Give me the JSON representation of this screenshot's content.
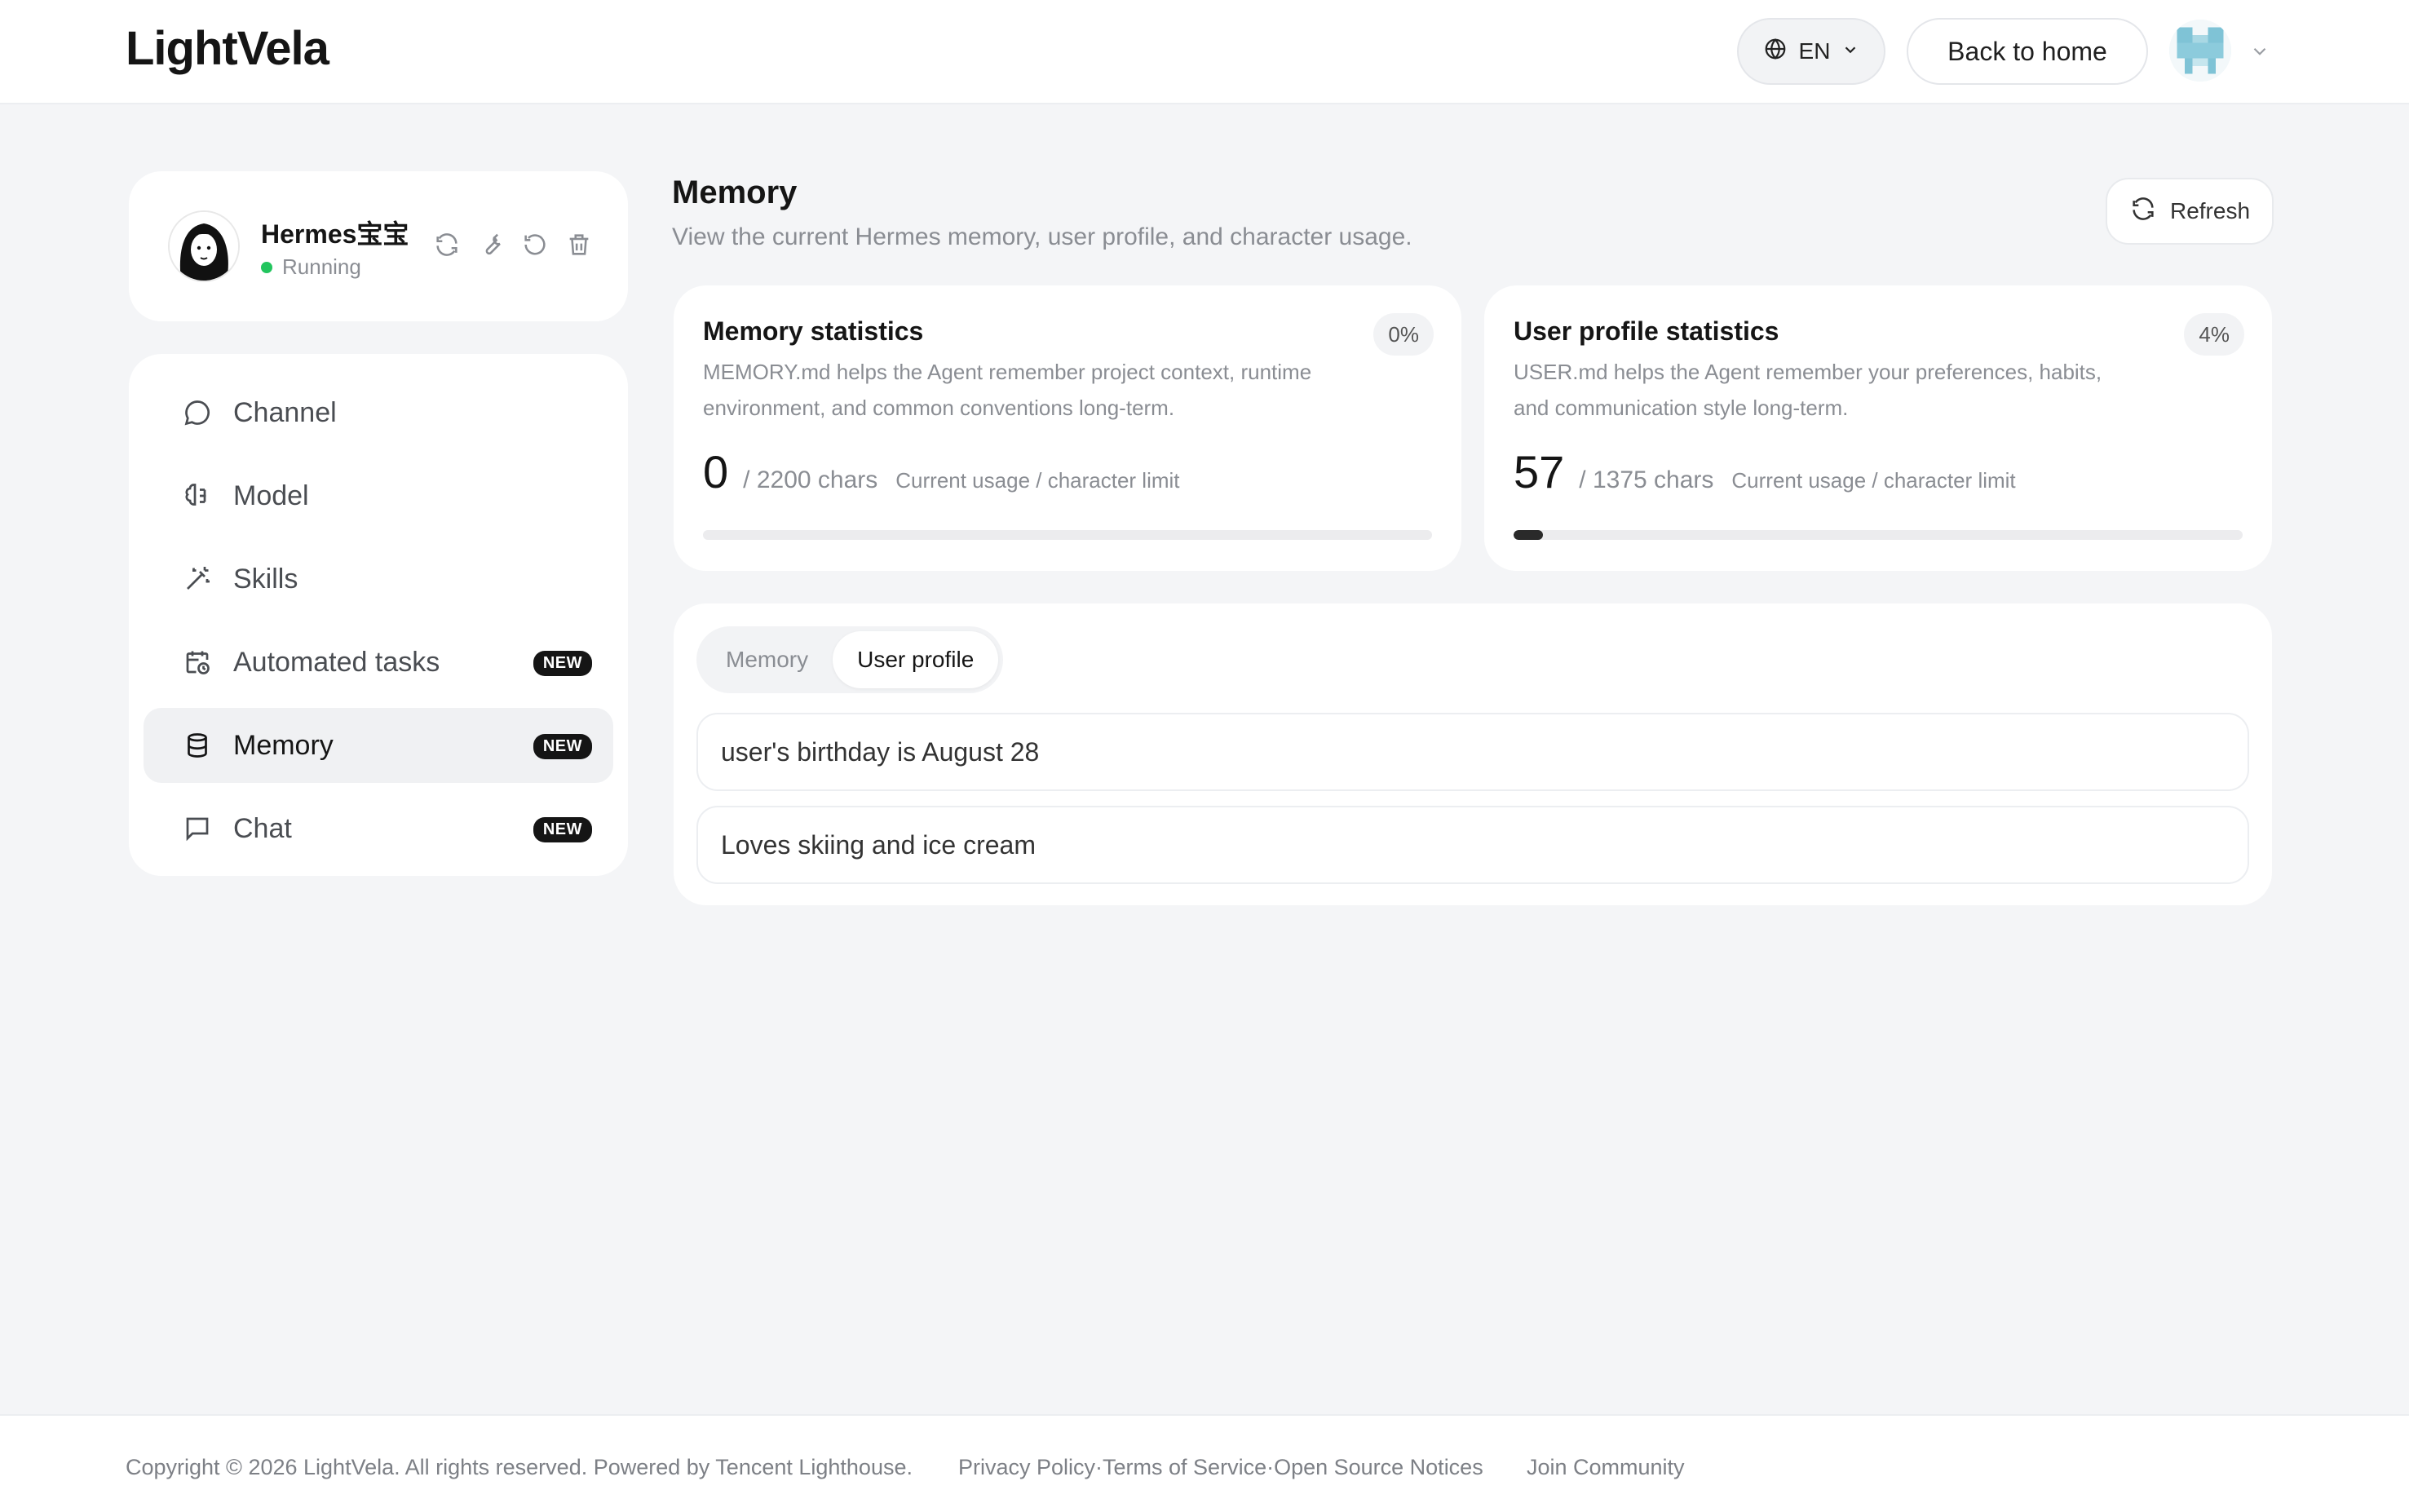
{
  "header": {
    "logo": "LightVela",
    "language": "EN",
    "back_home": "Back to home"
  },
  "agent": {
    "name": "Hermes宝宝",
    "status": "Running",
    "status_color": "#22c55e"
  },
  "nav": {
    "items": [
      {
        "label": "Channel",
        "icon": "chat-bubble-icon",
        "badge": ""
      },
      {
        "label": "Model",
        "icon": "brain-icon",
        "badge": ""
      },
      {
        "label": "Skills",
        "icon": "magic-wand-icon",
        "badge": ""
      },
      {
        "label": "Automated tasks",
        "icon": "calendar-clock-icon",
        "badge": "NEW"
      },
      {
        "label": "Memory",
        "icon": "database-icon",
        "badge": "NEW",
        "active": true
      },
      {
        "label": "Chat",
        "icon": "message-square-icon",
        "badge": "NEW"
      }
    ]
  },
  "page": {
    "title": "Memory",
    "subtitle": "View the current Hermes memory, user profile, and character usage.",
    "refresh_label": "Refresh"
  },
  "memory_stats": {
    "title": "Memory statistics",
    "description": "MEMORY.md helps the Agent remember project context, runtime environment, and common conventions long-term.",
    "percent_label": "0%",
    "current": "0",
    "limit": "/ 2200 chars",
    "caption": "Current usage / character limit",
    "progress_fraction": 0
  },
  "profile_stats": {
    "title": "User profile statistics",
    "description": "USER.md helps the Agent remember your preferences, habits, and communication style long-term.",
    "percent_label": "4%",
    "current": "57",
    "limit": "/ 1375 chars",
    "caption": "Current usage / character limit",
    "progress_fraction": 0.04
  },
  "tabs": {
    "memory": "Memory",
    "user_profile": "User profile",
    "active": "user_profile"
  },
  "entries": [
    "user's birthday is August 28",
    "Loves skiing and ice cream"
  ],
  "footer": {
    "copyright": "Copyright © 2026 LightVela. All rights reserved. Powered by Tencent Lighthouse.",
    "legal": "Privacy Policy·Terms of Service·Open Source Notices",
    "community": "Join Community"
  }
}
